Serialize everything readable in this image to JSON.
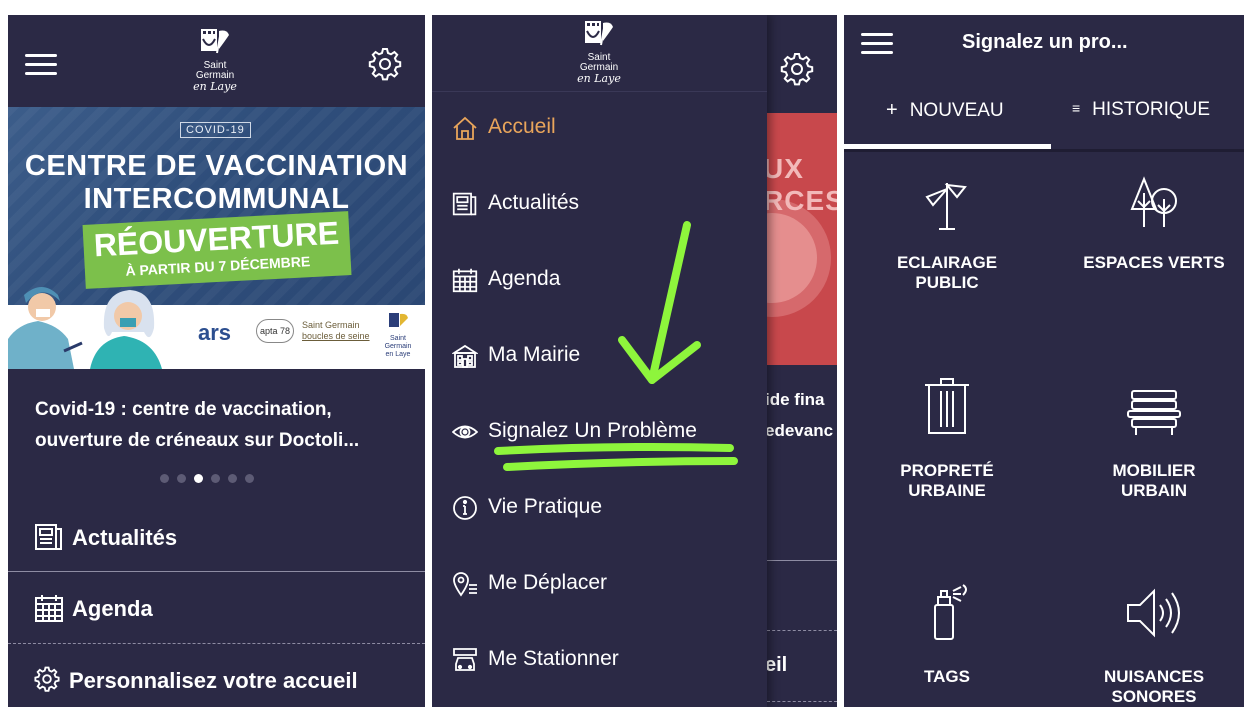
{
  "home": {
    "city_logo": {
      "line1": "Saint",
      "line2": "Germain",
      "line3": "en Laye"
    },
    "banner": {
      "tag": "COVID-19",
      "title1": "CENTRE DE VACCINATION",
      "title2": "INTERCOMMUNAL",
      "highlight1": "RÉOUVERTURE",
      "highlight2": "À PARTIR DU 7 DÉCEMBRE",
      "partner_ars": "ars",
      "partner_apta": "apta 78",
      "partner_sgb1": "Saint Germain",
      "partner_sgb2": "boucles de seine"
    },
    "news_headline_line1": "Covid-19 : centre de vaccination,",
    "news_headline_line2": "ouverture de créneaux sur Doctoli...",
    "carousel": {
      "count": 6,
      "active_index": 2
    },
    "sections": [
      {
        "label": "Actualités",
        "icon": "newspaper-icon"
      },
      {
        "label": "Agenda",
        "icon": "calendar-icon"
      },
      {
        "label": "Personnalisez votre accueil",
        "icon": "gear-icon"
      }
    ]
  },
  "drawer": {
    "items": [
      {
        "label": "Accueil",
        "icon": "home-icon",
        "active": true
      },
      {
        "label": "Actualités",
        "icon": "newspaper-icon"
      },
      {
        "label": "Agenda",
        "icon": "calendar-icon"
      },
      {
        "label": "Ma Mairie",
        "icon": "town-hall-icon"
      },
      {
        "label": "Signalez Un Problème",
        "icon": "eye-icon"
      },
      {
        "label": "Vie Pratique",
        "icon": "info-icon"
      },
      {
        "label": "Me Déplacer",
        "icon": "location-icon"
      },
      {
        "label": "Me Stationner",
        "icon": "car-icon"
      }
    ],
    "background_snippets": {
      "img_text1": "UX",
      "img_text2": "RCES",
      "line1": "ide fina",
      "line2": "edevanc",
      "row": "eil"
    },
    "accent_color": "#e9a55b",
    "annotation_color": "#8ef53c"
  },
  "report": {
    "title": "Signalez un pro...",
    "tabs": [
      {
        "label": "NOUVEAU",
        "icon": "plus-icon",
        "active": true
      },
      {
        "label": "HISTORIQUE",
        "icon": "list-icon"
      }
    ],
    "categories": [
      {
        "line1": "ECLAIRAGE",
        "line2": "PUBLIC",
        "icon": "street-light-icon"
      },
      {
        "line1": "ESPACES VERTS",
        "line2": "",
        "icon": "trees-icon"
      },
      {
        "line1": "PROPRETÉ",
        "line2": "URBAINE",
        "icon": "trash-can-icon"
      },
      {
        "line1": "MOBILIER",
        "line2": "URBAIN",
        "icon": "bench-icon"
      },
      {
        "line1": "TAGS",
        "line2": "",
        "icon": "spray-can-icon"
      },
      {
        "line1": "NUISANCES",
        "line2": "SONORES",
        "icon": "speaker-icon"
      }
    ]
  },
  "colors": {
    "app_background": "#2b2945",
    "text": "#ffffff"
  }
}
